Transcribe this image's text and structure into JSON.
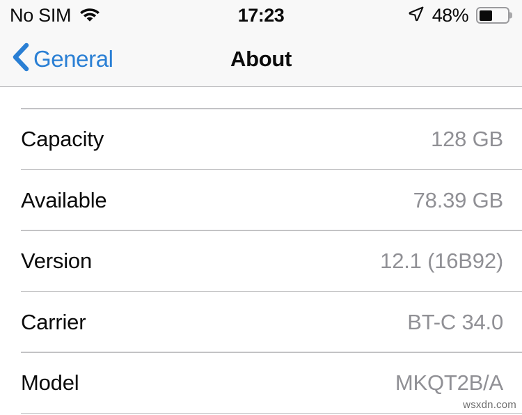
{
  "status_bar": {
    "carrier": "No SIM",
    "wifi_icon": "wifi-icon",
    "time": "17:23",
    "location_icon": "location-arrow-icon",
    "battery_percent_label": "48%",
    "battery_level": 48,
    "battery_icon": "battery-icon"
  },
  "nav_bar": {
    "back_icon": "chevron-left-icon",
    "back_label": "General",
    "title": "About"
  },
  "about_list": {
    "rows": [
      {
        "label": "Capacity",
        "value": "128 GB"
      },
      {
        "label": "Available",
        "value": "78.39 GB"
      },
      {
        "label": "Version",
        "value": "12.1 (16B92)"
      },
      {
        "label": "Carrier",
        "value": "BT-C 34.0"
      },
      {
        "label": "Model",
        "value": "MKQT2B/A"
      }
    ]
  },
  "watermark": "wsxdn.com",
  "colors": {
    "accent_blue": "#2a7fd4",
    "value_gray": "#909095",
    "separator": "#c3c3c5",
    "bar_background": "#f8f8f8",
    "text_primary": "#0a0a0a"
  }
}
